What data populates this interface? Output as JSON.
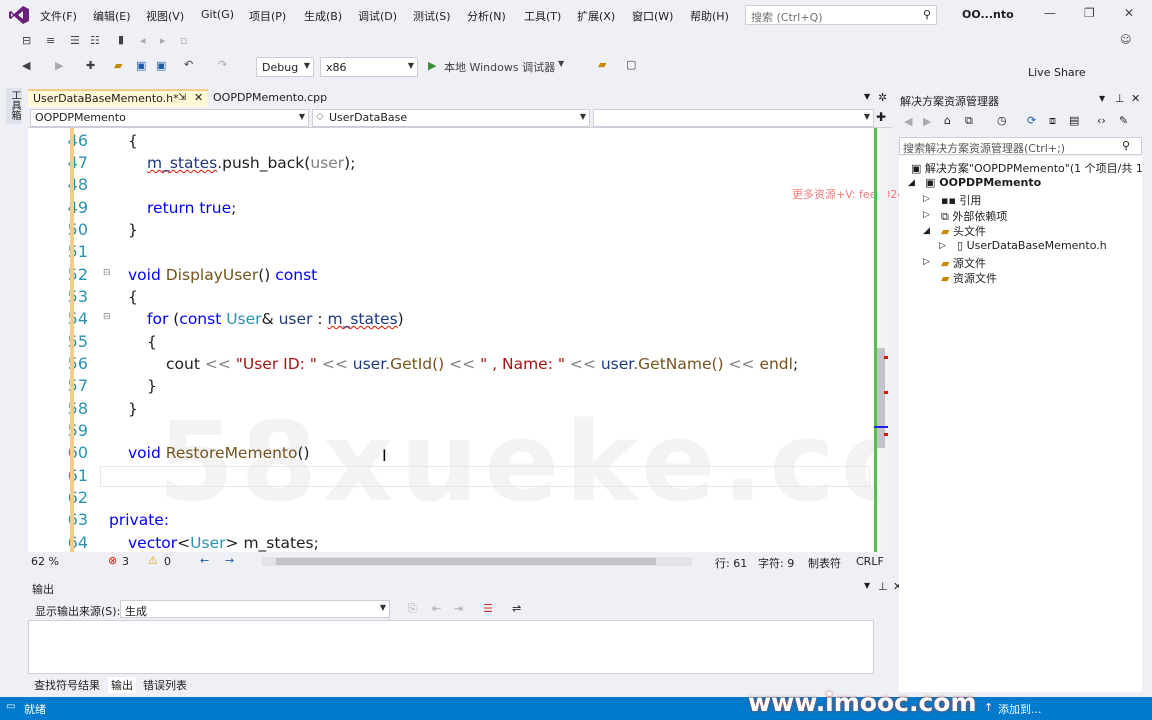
{
  "menu": {
    "items": [
      "文件(F)",
      "编辑(E)",
      "视图(V)",
      "Git(G)",
      "项目(P)",
      "生成(B)",
      "调试(D)",
      "测试(S)",
      "分析(N)",
      "工具(T)",
      "扩展(X)",
      "窗口(W)",
      "帮助(H)"
    ],
    "search_placeholder": "搜索 (Ctrl+Q)",
    "solution_short": "OO...nto"
  },
  "toolbar": {
    "config": "Debug",
    "platform": "x86",
    "run_label": "本地 Windows 调试器",
    "live_share": "Live Share"
  },
  "left_strip": {
    "toolbox": "工具箱"
  },
  "tabs": [
    {
      "label": "UserDataBaseMemento.h*",
      "active": true
    },
    {
      "label": "OOPDPMemento.cpp",
      "active": false
    }
  ],
  "navbar": {
    "project": "OOPDPMemento",
    "scope": "UserDataBase"
  },
  "code_lines": [
    {
      "num": "46"
    },
    {
      "num": "47"
    },
    {
      "num": "48"
    },
    {
      "num": "49"
    },
    {
      "num": "50"
    },
    {
      "num": "51"
    },
    {
      "num": "52"
    },
    {
      "num": "53"
    },
    {
      "num": "54"
    },
    {
      "num": "55"
    },
    {
      "num": "56"
    },
    {
      "num": "57"
    },
    {
      "num": "58"
    },
    {
      "num": "59"
    },
    {
      "num": "60"
    },
    {
      "num": "61"
    },
    {
      "num": "62"
    },
    {
      "num": "63"
    },
    {
      "num": "64"
    }
  ],
  "code": {
    "l46": "{",
    "l47_a": "m_states",
    "l47_b": ".push_back(",
    "l47_c": "user",
    "l47_d": ");",
    "l49_kw": "return",
    "l49_val": "true",
    "l49_end": ";",
    "l50": "}",
    "l52_void": "void",
    "l52_fn": "DisplayUser",
    "l52_paren": "()",
    "l52_const": "const",
    "l53": "{",
    "l54_for": "for",
    "l54_a": " (",
    "l54_const": "const",
    "l54_type": "User",
    "l54_b": "& ",
    "l54_user": "user",
    "l54_c": " : ",
    "l54_mstates": "m_states",
    "l54_d": ")",
    "l55": "{",
    "l56_cout": "cout",
    "l56_op1": " << ",
    "l56_s1": "\"User ID: \"",
    "l56_op2": " << ",
    "l56_user1": "user",
    "l56_getid": ".GetId()",
    "l56_op3": " << ",
    "l56_s2": "\" , Name: \"",
    "l56_op4": " << ",
    "l56_user2": "user",
    "l56_getname": ".GetName()",
    "l56_op5": " << ",
    "l56_endl": "endl",
    "l56_end": ";",
    "l57": "}",
    "l58": "}",
    "l60_void": "void",
    "l60_fn": "RestoreMemento",
    "l60_paren": "()",
    "l63": "private:",
    "l64_vector": "vector",
    "l64_lt": "<",
    "l64_user": "User",
    "l64_gt": ">",
    "l64_var": " m_states;"
  },
  "overlay": {
    "promo": "更多资源+V: feee024",
    "watermark": "58xueke.com",
    "imooc": "www.imooc.com"
  },
  "editor_status": {
    "zoom": "62 %",
    "errors": "3",
    "warnings": "0",
    "line": "行: 61",
    "char": "字符: 9",
    "tabs": "制表符",
    "eol": "CRLF"
  },
  "output": {
    "title": "输出",
    "source_label": "显示输出来源(S):",
    "source_value": "生成",
    "tabs": [
      "查找符号结果",
      "输出",
      "错误列表"
    ]
  },
  "solution_explorer": {
    "title": "解决方案资源管理器",
    "search_placeholder": "搜索解决方案资源管理器(Ctrl+;)",
    "solution": "解决方案\"OOPDPMemento\"(1 个项目/共 1",
    "project": "OOPDPMemento",
    "items": [
      "引用",
      "外部依赖项",
      "头文件",
      "UserDataBaseMemento.h",
      "源文件",
      "资源文件"
    ]
  },
  "statusbar": {
    "ready": "就绪",
    "add": "添加到..."
  }
}
